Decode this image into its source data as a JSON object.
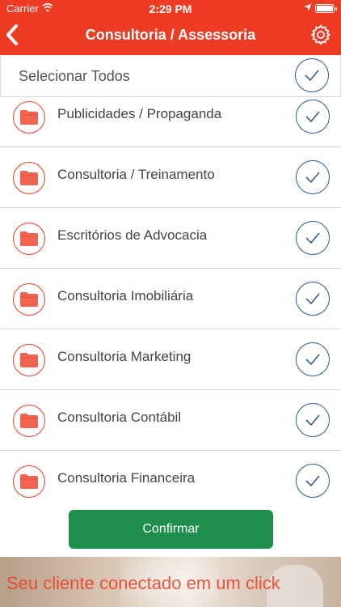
{
  "status_bar": {
    "carrier": "Carrier",
    "time": "2:29 PM"
  },
  "nav": {
    "title": "Consultoria / Assessoria"
  },
  "select_all": {
    "label": "Selecionar Todos",
    "checked": true
  },
  "items": [
    {
      "label": "Publicidades / Propaganda",
      "checked": true
    },
    {
      "label": "Consultoria / Treinamento",
      "checked": true
    },
    {
      "label": "Escritórios de Advocacia",
      "checked": true
    },
    {
      "label": "Consultoria Imobiliária",
      "checked": true
    },
    {
      "label": "Consultoria Marketing",
      "checked": true
    },
    {
      "label": "Consultoria Contábil",
      "checked": true
    },
    {
      "label": "Consultoria Financeira",
      "checked": true
    }
  ],
  "confirm_label": "Confirmar",
  "banner": {
    "text": "Seu cliente conectado em um click"
  },
  "colors": {
    "accent": "#ee3b23",
    "confirm": "#1f8f4e",
    "check": "#2f5b8e"
  },
  "icons": {
    "item": "folder-icon",
    "check": "checkmark-icon",
    "back": "chevron-left-icon",
    "settings": "gear-icon"
  }
}
